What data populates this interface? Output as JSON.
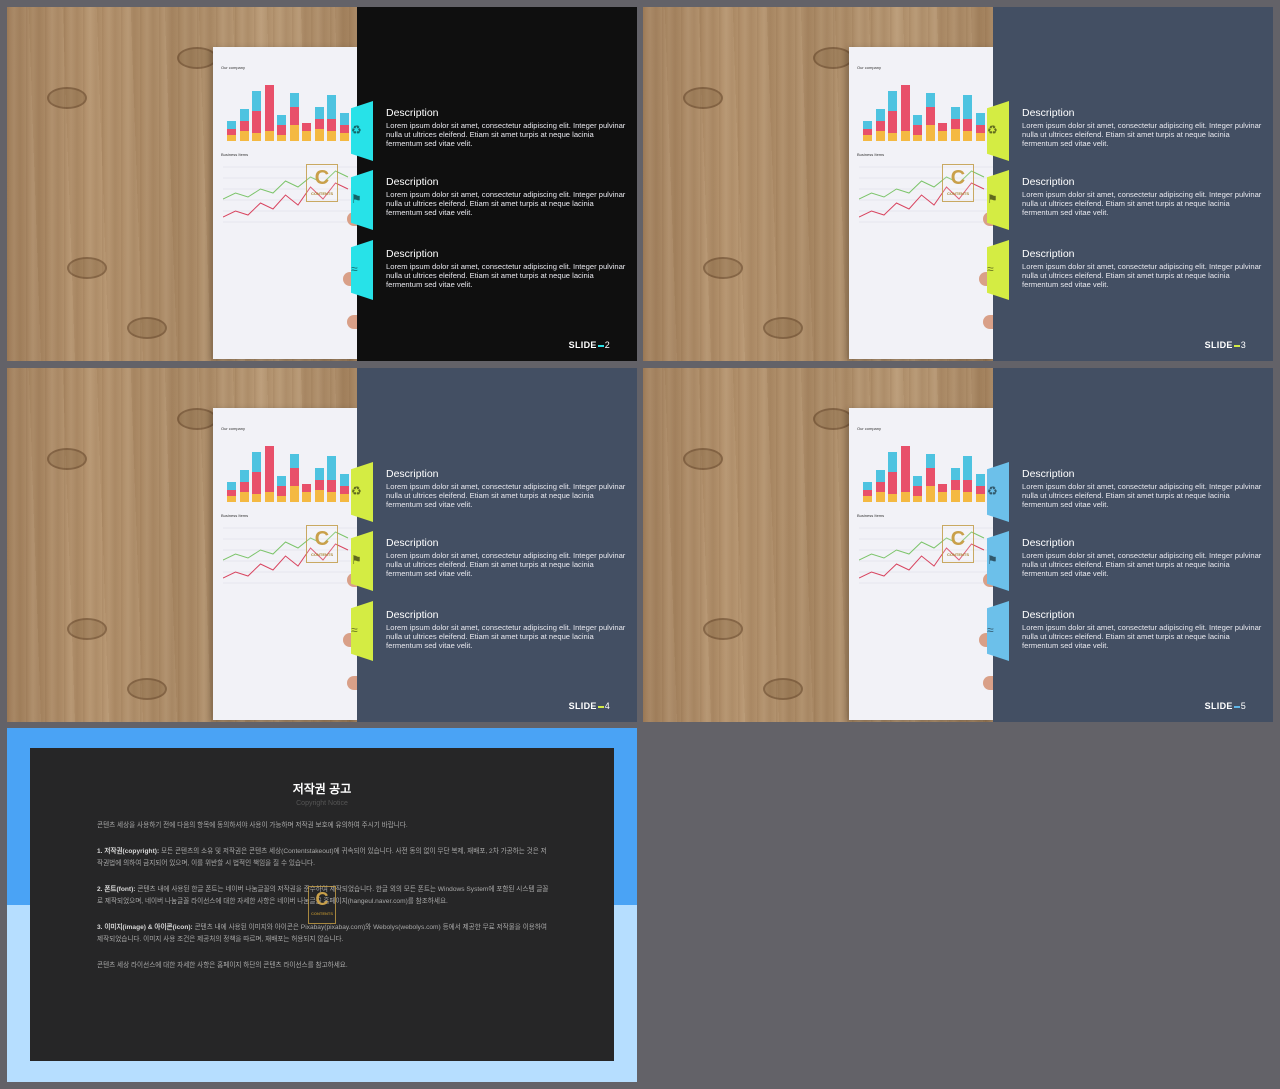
{
  "slides": [
    {
      "number": "2",
      "slide_label": "SLIDE",
      "panel_color": "#0f0f0f",
      "tab_color": "#27e2e8",
      "accent_color": "#27e2e8",
      "paper": {
        "title": "Our company",
        "subtitle": "Business Items",
        "logo_letter": "C",
        "logo_text": "CONTENTS"
      },
      "items": [
        {
          "title": "Description",
          "text": "Lorem ipsum dolor sit amet, consectetur adipiscing elit. Integer pulvinar nulla ut ultrices eleifend. Etiam sit amet turpis at neque lacinia fermentum sed vitae velit."
        },
        {
          "title": "Description",
          "text": "Lorem ipsum dolor sit amet, consectetur adipiscing elit. Integer pulvinar nulla ut ultrices eleifend. Etiam sit amet turpis at neque lacinia fermentum sed vitae velit."
        },
        {
          "title": "Description",
          "text": "Lorem ipsum dolor sit amet, consectetur adipiscing elit. Integer pulvinar nulla ut ultrices eleifend. Etiam sit amet turpis at neque lacinia fermentum sed vitae velit."
        }
      ]
    },
    {
      "number": "3",
      "slide_label": "SLIDE",
      "panel_color": "#434f63",
      "tab_color": "#d4ec43",
      "accent_color": "#d4ec43",
      "paper": {
        "title": "Our company",
        "subtitle": "Business Items",
        "logo_letter": "C",
        "logo_text": "CONTENTS"
      },
      "items": [
        {
          "title": "Description",
          "text": "Lorem ipsum dolor sit amet, consectetur adipiscing elit. Integer pulvinar nulla ut ultrices eleifend. Etiam sit amet turpis at neque lacinia fermentum sed vitae velit."
        },
        {
          "title": "Description",
          "text": "Lorem ipsum dolor sit amet, consectetur adipiscing elit. Integer pulvinar nulla ut ultrices eleifend. Etiam sit amet turpis at neque lacinia fermentum sed vitae velit."
        },
        {
          "title": "Description",
          "text": "Lorem ipsum dolor sit amet, consectetur adipiscing elit. Integer pulvinar nulla ut ultrices eleifend. Etiam sit amet turpis at neque lacinia fermentum sed vitae velit."
        }
      ]
    },
    {
      "number": "4",
      "slide_label": "SLIDE",
      "panel_color": "#434f63",
      "tab_color": "#d4ec43",
      "accent_color": "#d4ec43",
      "paper": {
        "title": "Our company",
        "subtitle": "Business Items",
        "logo_letter": "C",
        "logo_text": "CONTENTS"
      },
      "items": [
        {
          "title": "Description",
          "text": "Lorem ipsum dolor sit amet, consectetur adipiscing elit. Integer pulvinar nulla ut ultrices eleifend. Etiam sit amet turpis at neque lacinia fermentum sed vitae velit."
        },
        {
          "title": "Description",
          "text": "Lorem ipsum dolor sit amet, consectetur adipiscing elit. Integer pulvinar nulla ut ultrices eleifend. Etiam sit amet turpis at neque lacinia fermentum sed vitae velit."
        },
        {
          "title": "Description",
          "text": "Lorem ipsum dolor sit amet, consectetur adipiscing elit. Integer pulvinar nulla ut ultrices eleifend. Etiam sit amet turpis at neque lacinia fermentum sed vitae velit."
        }
      ]
    },
    {
      "number": "5",
      "slide_label": "SLIDE",
      "panel_color": "#434f63",
      "tab_color": "#6cc0ea",
      "accent_color": "#5fb6e8",
      "paper": {
        "title": "Our company",
        "subtitle": "Business Items",
        "logo_letter": "C",
        "logo_text": "CONTENTS"
      },
      "items": [
        {
          "title": "Description",
          "text": "Lorem ipsum dolor sit amet, consectetur adipiscing elit. Integer pulvinar nulla ut ultrices eleifend. Etiam sit amet turpis at neque lacinia fermentum sed vitae velit."
        },
        {
          "title": "Description",
          "text": "Lorem ipsum dolor sit amet, consectetur adipiscing elit. Integer pulvinar nulla ut ultrices eleifend. Etiam sit amet turpis at neque lacinia fermentum sed vitae velit."
        },
        {
          "title": "Description",
          "text": "Lorem ipsum dolor sit amet, consectetur adipiscing elit. Integer pulvinar nulla ut ultrices eleifend. Etiam sit amet turpis at neque lacinia fermentum sed vitae velit."
        }
      ]
    }
  ],
  "paper_chart": {
    "stack_colors": [
      "#f4b942",
      "#e8506a",
      "#4ec3e0"
    ],
    "bars": [
      [
        6,
        6,
        8
      ],
      [
        10,
        10,
        12
      ],
      [
        8,
        22,
        20
      ],
      [
        10,
        46,
        0
      ],
      [
        6,
        10,
        10
      ],
      [
        16,
        18,
        14
      ],
      [
        10,
        8,
        0
      ],
      [
        12,
        10,
        12
      ],
      [
        10,
        12,
        24
      ],
      [
        8,
        8,
        12
      ]
    ],
    "line_green": [
      40,
      34,
      38,
      30,
      34,
      22,
      28,
      18,
      24,
      12,
      18
    ],
    "line_red": [
      58,
      52,
      56,
      44,
      50,
      36,
      46,
      28,
      40,
      24,
      30
    ],
    "green_color": "#7cc46a",
    "red_color": "#d8445f"
  },
  "copyright": {
    "title": "저작권 공고",
    "subtitle": "Copyright Notice",
    "paragraphs": [
      {
        "lead": "",
        "text": "콘텐츠 세상을 사용하기 전에 다음의 항목에 동의하셔야 사용이 가능하며 저작권 보호에 유의하여 주시기 바랍니다."
      },
      {
        "lead": "1. 저작권(copyright):",
        "text": " 모든 콘텐츠의 소유 및 저작권은 콘텐츠 세상(Contentstakeout)에 귀속되어 있습니다. 사전 동의 없이 무단 복제, 재배포, 2차 가공하는 것은 저작권법에 의하여 금지되어 있으며, 이를 위반할 시 법적인 책임을 질 수 있습니다."
      },
      {
        "lead": "2. 폰트(font):",
        "text": " 콘텐츠 내에 사용된 한글 폰트는 네이버 나눔글꼴의 저작권을 준수하여 제작되었습니다. 한글 외의 모든 폰트는 Windows System에 포함된 시스템 글꼴로 제작되었으며, 네이버 나눔글꼴 라이선스에 대한 자세한 사항은 네이버 나눔글꼴 홈페이지(hangeul.naver.com)를 참조하세요."
      },
      {
        "lead": "3. 이미지(image) & 아이콘(icon):",
        "text": " 콘텐츠 내에 사용된 이미지와 아이콘은 Pixabay(pixabay.com)와 Webolys(webolys.com) 등에서 제공한 무료 저작물을 이용하여 제작되었습니다. 이미지 사용 조건은 제공처의 정책을 따르며, 재배포는 허용되지 않습니다."
      },
      {
        "lead": "",
        "text": "콘텐츠 세상 라이선스에 대한 자세한 사항은 홈페이지 하단의 콘텐츠 라이선스를 참고하세요."
      }
    ],
    "logo_letter": "C",
    "logo_text": "CONTENTS"
  }
}
